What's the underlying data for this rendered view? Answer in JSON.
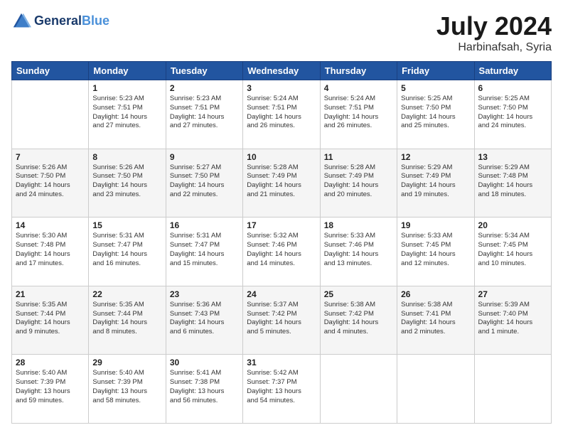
{
  "logo": {
    "line1": "General",
    "line2": "Blue"
  },
  "title": {
    "month_year": "July 2024",
    "location": "Harbinafsah, Syria"
  },
  "weekdays": [
    "Sunday",
    "Monday",
    "Tuesday",
    "Wednesday",
    "Thursday",
    "Friday",
    "Saturday"
  ],
  "weeks": [
    [
      {
        "day": "",
        "info": ""
      },
      {
        "day": "1",
        "info": "Sunrise: 5:23 AM\nSunset: 7:51 PM\nDaylight: 14 hours\nand 27 minutes."
      },
      {
        "day": "2",
        "info": "Sunrise: 5:23 AM\nSunset: 7:51 PM\nDaylight: 14 hours\nand 27 minutes."
      },
      {
        "day": "3",
        "info": "Sunrise: 5:24 AM\nSunset: 7:51 PM\nDaylight: 14 hours\nand 26 minutes."
      },
      {
        "day": "4",
        "info": "Sunrise: 5:24 AM\nSunset: 7:51 PM\nDaylight: 14 hours\nand 26 minutes."
      },
      {
        "day": "5",
        "info": "Sunrise: 5:25 AM\nSunset: 7:50 PM\nDaylight: 14 hours\nand 25 minutes."
      },
      {
        "day": "6",
        "info": "Sunrise: 5:25 AM\nSunset: 7:50 PM\nDaylight: 14 hours\nand 24 minutes."
      }
    ],
    [
      {
        "day": "7",
        "info": "Sunrise: 5:26 AM\nSunset: 7:50 PM\nDaylight: 14 hours\nand 24 minutes."
      },
      {
        "day": "8",
        "info": "Sunrise: 5:26 AM\nSunset: 7:50 PM\nDaylight: 14 hours\nand 23 minutes."
      },
      {
        "day": "9",
        "info": "Sunrise: 5:27 AM\nSunset: 7:50 PM\nDaylight: 14 hours\nand 22 minutes."
      },
      {
        "day": "10",
        "info": "Sunrise: 5:28 AM\nSunset: 7:49 PM\nDaylight: 14 hours\nand 21 minutes."
      },
      {
        "day": "11",
        "info": "Sunrise: 5:28 AM\nSunset: 7:49 PM\nDaylight: 14 hours\nand 20 minutes."
      },
      {
        "day": "12",
        "info": "Sunrise: 5:29 AM\nSunset: 7:49 PM\nDaylight: 14 hours\nand 19 minutes."
      },
      {
        "day": "13",
        "info": "Sunrise: 5:29 AM\nSunset: 7:48 PM\nDaylight: 14 hours\nand 18 minutes."
      }
    ],
    [
      {
        "day": "14",
        "info": "Sunrise: 5:30 AM\nSunset: 7:48 PM\nDaylight: 14 hours\nand 17 minutes."
      },
      {
        "day": "15",
        "info": "Sunrise: 5:31 AM\nSunset: 7:47 PM\nDaylight: 14 hours\nand 16 minutes."
      },
      {
        "day": "16",
        "info": "Sunrise: 5:31 AM\nSunset: 7:47 PM\nDaylight: 14 hours\nand 15 minutes."
      },
      {
        "day": "17",
        "info": "Sunrise: 5:32 AM\nSunset: 7:46 PM\nDaylight: 14 hours\nand 14 minutes."
      },
      {
        "day": "18",
        "info": "Sunrise: 5:33 AM\nSunset: 7:46 PM\nDaylight: 14 hours\nand 13 minutes."
      },
      {
        "day": "19",
        "info": "Sunrise: 5:33 AM\nSunset: 7:45 PM\nDaylight: 14 hours\nand 12 minutes."
      },
      {
        "day": "20",
        "info": "Sunrise: 5:34 AM\nSunset: 7:45 PM\nDaylight: 14 hours\nand 10 minutes."
      }
    ],
    [
      {
        "day": "21",
        "info": "Sunrise: 5:35 AM\nSunset: 7:44 PM\nDaylight: 14 hours\nand 9 minutes."
      },
      {
        "day": "22",
        "info": "Sunrise: 5:35 AM\nSunset: 7:44 PM\nDaylight: 14 hours\nand 8 minutes."
      },
      {
        "day": "23",
        "info": "Sunrise: 5:36 AM\nSunset: 7:43 PM\nDaylight: 14 hours\nand 6 minutes."
      },
      {
        "day": "24",
        "info": "Sunrise: 5:37 AM\nSunset: 7:42 PM\nDaylight: 14 hours\nand 5 minutes."
      },
      {
        "day": "25",
        "info": "Sunrise: 5:38 AM\nSunset: 7:42 PM\nDaylight: 14 hours\nand 4 minutes."
      },
      {
        "day": "26",
        "info": "Sunrise: 5:38 AM\nSunset: 7:41 PM\nDaylight: 14 hours\nand 2 minutes."
      },
      {
        "day": "27",
        "info": "Sunrise: 5:39 AM\nSunset: 7:40 PM\nDaylight: 14 hours\nand 1 minute."
      }
    ],
    [
      {
        "day": "28",
        "info": "Sunrise: 5:40 AM\nSunset: 7:39 PM\nDaylight: 13 hours\nand 59 minutes."
      },
      {
        "day": "29",
        "info": "Sunrise: 5:40 AM\nSunset: 7:39 PM\nDaylight: 13 hours\nand 58 minutes."
      },
      {
        "day": "30",
        "info": "Sunrise: 5:41 AM\nSunset: 7:38 PM\nDaylight: 13 hours\nand 56 minutes."
      },
      {
        "day": "31",
        "info": "Sunrise: 5:42 AM\nSunset: 7:37 PM\nDaylight: 13 hours\nand 54 minutes."
      },
      {
        "day": "",
        "info": ""
      },
      {
        "day": "",
        "info": ""
      },
      {
        "day": "",
        "info": ""
      }
    ]
  ]
}
